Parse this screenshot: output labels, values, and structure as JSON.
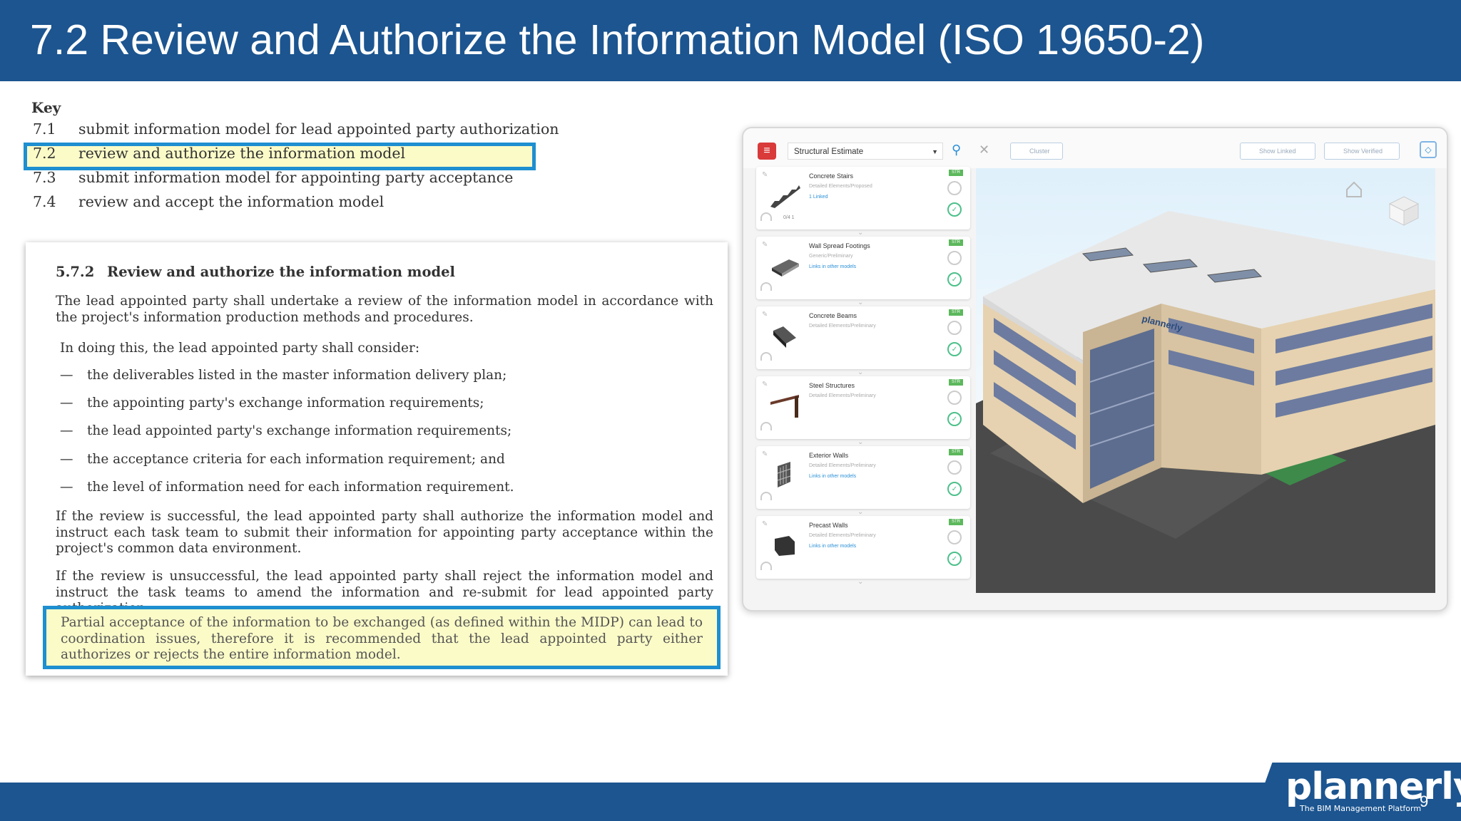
{
  "slide": {
    "title": "7.2  Review and Authorize the Information Model  (ISO 19650-2)",
    "page_number": "9"
  },
  "key": {
    "heading": "Key",
    "items": [
      {
        "num": "7.1",
        "text": "submit information model for lead appointed party authorization"
      },
      {
        "num": "7.2",
        "text": "review and authorize the information model"
      },
      {
        "num": "7.3",
        "text": "submit information model for appointing party acceptance"
      },
      {
        "num": "7.4",
        "text": "review and accept the information model"
      }
    ]
  },
  "doc": {
    "section_num": "5.7.2",
    "section_title": "Review and authorize the information model",
    "p1": "The lead appointed party shall undertake a review of the information model in accordance with the project's information production methods and procedures.",
    "p2": "In doing this, the lead appointed party shall consider:",
    "bullets": [
      "the deliverables listed in the master information delivery plan;",
      "the appointing party's exchange information requirements;",
      "the lead appointed party's exchange information requirements;",
      "the acceptance criteria for each information requirement; and",
      "the level of information need for each information requirement."
    ],
    "p3": "If the review is successful, the lead appointed party shall authorize the information model and instruct each task team to submit their information for appointing party acceptance within the project's common data environment.",
    "p4": "If the review is unsuccessful, the lead appointed party shall reject the information model and instruct the task teams to amend the information and re-submit for lead appointed party authorization.",
    "note": "Partial acceptance of the information to be exchanged (as defined within the MIDP) can lead to coordination issues, therefore it is recommended that the lead appointed party either authorizes or rejects the entire information model."
  },
  "app": {
    "dropdown_value": "Structural Estimate",
    "cluster_label": "Cluster",
    "show_linked_label": "Show Linked",
    "show_verified_label": "Show Verified",
    "building_sign": "plannerly",
    "items": [
      {
        "name": "Concrete Stairs",
        "sub": "Detailed Elements/Proposed",
        "link": "1 Linked",
        "meta": "0/4   1",
        "tag": "STR"
      },
      {
        "name": "Wall Spread Footings",
        "sub": "Generic/Preliminary",
        "link": "Links in other models",
        "meta": "",
        "tag": "STR"
      },
      {
        "name": "Concrete Beams",
        "sub": "Detailed Elements/Preliminary",
        "link": "",
        "meta": "",
        "tag": "STR"
      },
      {
        "name": "Steel Structures",
        "sub": "Detailed Elements/Preliminary",
        "link": "",
        "meta": "",
        "tag": "STR"
      },
      {
        "name": "Exterior Walls",
        "sub": "Detailed Elements/Preliminary",
        "link": "Links in other models",
        "meta": "",
        "tag": "STR"
      },
      {
        "name": "Precast Walls",
        "sub": "Detailed Elements/Preliminary",
        "link": "Links in other models",
        "meta": "",
        "tag": "STR"
      }
    ]
  },
  "brand": {
    "logo": "plannerly",
    "tagline": "The BIM Management Platform"
  },
  "colors": {
    "header": "#1c5590",
    "highlight_border": "#1e8fd0",
    "highlight_fill": "#fbfbc8"
  }
}
